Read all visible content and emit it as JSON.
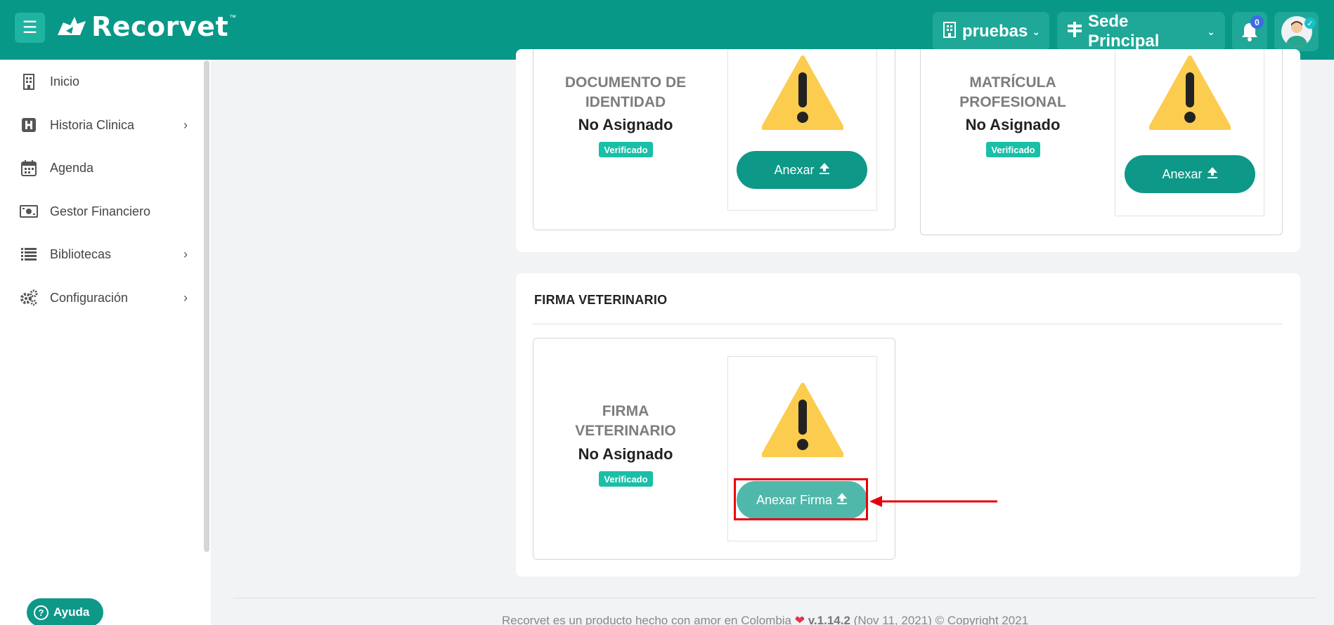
{
  "header": {
    "logo_text": "Recorvet",
    "logo_tm": "™",
    "clinic_selector": "pruebas",
    "branch_selector": "Sede Principal",
    "notifications_count": "0"
  },
  "sidebar": {
    "items": [
      {
        "label": "Inicio",
        "icon": "building-icon",
        "has_submenu": false
      },
      {
        "label": "Historia Clinica",
        "icon": "hospital-icon",
        "has_submenu": true
      },
      {
        "label": "Agenda",
        "icon": "calendar-icon",
        "has_submenu": false
      },
      {
        "label": "Gestor Financiero",
        "icon": "money-icon",
        "has_submenu": false
      },
      {
        "label": "Bibliotecas",
        "icon": "list-icon",
        "has_submenu": true
      },
      {
        "label": "Configuración",
        "icon": "gears-icon",
        "has_submenu": true
      }
    ],
    "help_label": "Ayuda"
  },
  "documents": {
    "identity": {
      "title_line1": "DOCUMENTO DE",
      "title_line2": "IDENTIDAD",
      "status": "No Asignado",
      "badge": "Verificado",
      "button": "Anexar"
    },
    "license": {
      "title_line1": "MATRÍCULA",
      "title_line2": "PROFESIONAL",
      "status": "No Asignado",
      "badge": "Verificado",
      "button": "Anexar"
    }
  },
  "signature_section": {
    "heading": "FIRMA VETERINARIO",
    "title_line1": "FIRMA",
    "title_line2": "VETERINARIO",
    "status": "No Asignado",
    "badge": "Verificado",
    "button": "Anexar Firma"
  },
  "footer": {
    "text_before": "Recorvet es un producto hecho con amor en Colombia",
    "version": "v.1.14.2",
    "text_after": "(Nov 11, 2021) © Copyright 2021"
  },
  "colors": {
    "brand": "#079888",
    "warning": "#fccc4f",
    "highlight": "#e8000a",
    "badge": "#19bfa7"
  }
}
